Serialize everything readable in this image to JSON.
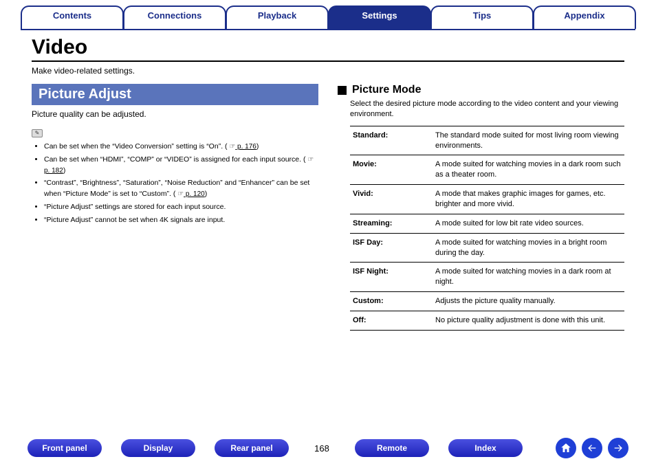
{
  "tabs": {
    "items": [
      "Contents",
      "Connections",
      "Playback",
      "Settings",
      "Tips",
      "Appendix"
    ],
    "active_index": 3
  },
  "page": {
    "title": "Video",
    "intro": "Make video-related settings."
  },
  "picture_adjust": {
    "heading": "Picture Adjust",
    "sub": "Picture quality can be adjusted.",
    "notes": [
      {
        "text_a": "Can be set when the “Video Conversion” setting is “On”.  (",
        "ref_icon": "☞",
        "ref_link": " p. 176",
        "text_b": ")"
      },
      {
        "text_a": "Can be set when “HDMI”, “COMP” or “VIDEO” is assigned for each input source. (",
        "ref_icon": "☞",
        "ref_link": " p. 182",
        "text_b": ")"
      },
      {
        "text_a": "“Contrast”, “Brightness”, “Saturation”, “Noise Reduction” and “Enhancer” can be set when “Picture Mode” is set to “Custom”.  (",
        "ref_icon": "☞",
        "ref_link": " p. 120",
        "text_b": ")"
      },
      {
        "text_a": "“Picture Adjust” settings are stored for each input source."
      },
      {
        "text_a": "“Picture Adjust” cannot be set when 4K signals are input."
      }
    ]
  },
  "picture_mode": {
    "heading": "Picture Mode",
    "intro": "Select the desired picture mode according to the video content and your viewing environment.",
    "rows": [
      {
        "k": "Standard:",
        "v": "The standard mode suited for most living room viewing environments."
      },
      {
        "k": "Movie:",
        "v": "A mode suited for watching movies in a dark room such as a theater room."
      },
      {
        "k": "Vivid:",
        "v": "A mode that makes graphic images for games, etc. brighter and more vivid."
      },
      {
        "k": "Streaming:",
        "v": "A mode suited for low bit rate video sources."
      },
      {
        "k": "ISF Day:",
        "v": "A mode suited for watching movies in a bright room during the day."
      },
      {
        "k": "ISF Night:",
        "v": "A mode suited for watching movies in a dark room at night."
      },
      {
        "k": "Custom:",
        "v": "Adjusts the picture quality manually."
      },
      {
        "k": "Off:",
        "v": "No picture quality adjustment is done with this unit."
      }
    ]
  },
  "footer": {
    "buttons": [
      "Front panel",
      "Display",
      "Rear panel",
      "Remote",
      "Index"
    ],
    "page_number": "168"
  }
}
